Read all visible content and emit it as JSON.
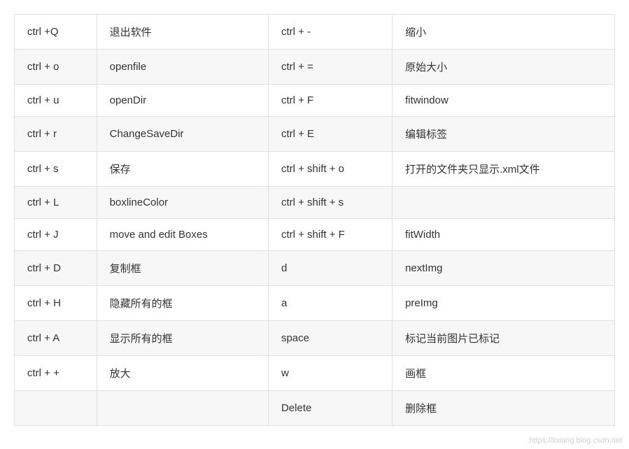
{
  "table": {
    "rows": [
      [
        "ctrl +Q",
        "退出软件",
        "ctrl + -",
        "缩小"
      ],
      [
        "ctrl + o",
        "openfile",
        "ctrl + =",
        "原始大小"
      ],
      [
        "ctrl + u",
        "openDir",
        "ctrl + F",
        "fitwindow"
      ],
      [
        "ctrl + r",
        "ChangeSaveDir",
        "ctrl + E",
        "编辑标签"
      ],
      [
        "ctrl + s",
        "保存",
        "ctrl + shift + o",
        "打开的文件夹只显示.xml文件"
      ],
      [
        "ctrl + L",
        "boxlineColor",
        "ctrl + shift + s",
        ""
      ],
      [
        "ctrl + J",
        "move and edit Boxes",
        "ctrl + shift + F",
        "fitWidth"
      ],
      [
        "ctrl + D",
        "复制框",
        "d",
        "nextImg"
      ],
      [
        "ctrl + H",
        "隐藏所有的框",
        "a",
        "preImg"
      ],
      [
        "ctrl + A",
        "显示所有的框",
        "space",
        "标记当前图片已标记"
      ],
      [
        "ctrl + +",
        "放大",
        "w",
        "画框"
      ],
      [
        "",
        "",
        "Delete",
        "删除框"
      ]
    ]
  },
  "watermark": "https://lixiang.blog.csdn.net"
}
